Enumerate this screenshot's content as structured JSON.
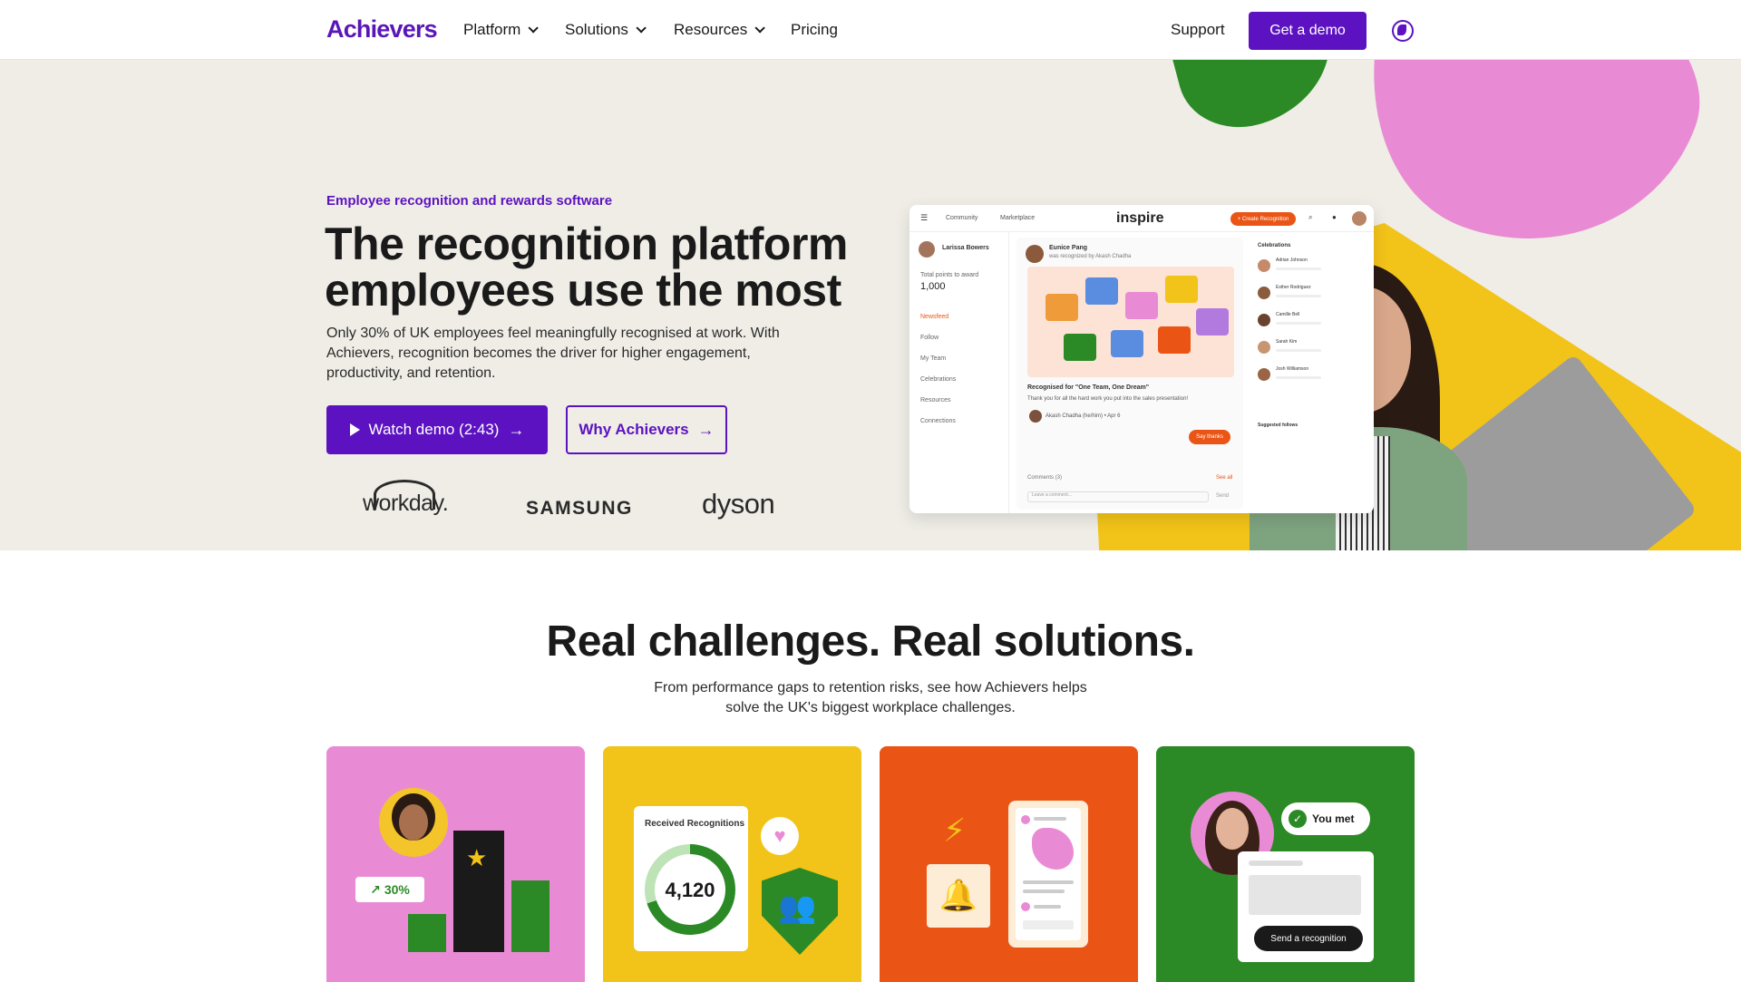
{
  "nav": {
    "logo": "Achievers",
    "items": [
      {
        "label": "Platform",
        "has_dropdown": true
      },
      {
        "label": "Solutions",
        "has_dropdown": true
      },
      {
        "label": "Resources",
        "has_dropdown": true
      },
      {
        "label": "Pricing",
        "has_dropdown": false
      }
    ],
    "support": "Support",
    "cta": "Get a demo",
    "globe_icon": "globe-icon"
  },
  "hero": {
    "eyebrow": "Employee recognition and rewards software",
    "title": "The recognition platform employees use the most",
    "lede": "Only 30% of UK employees feel meaningfully recognised at work. With Achievers, recognition becomes the driver for higher engagement, productivity, and retention.",
    "watch_label": "Watch demo (2:43)",
    "why_label": "Why Achievers",
    "logos": [
      "workday.",
      "SAMSUNG",
      "dyson"
    ]
  },
  "mock": {
    "app_title": "inspire",
    "tabs": [
      "Community",
      "Marketplace"
    ],
    "create_label": "+ Create Recognition",
    "user": "Larissa Bowers",
    "points_label": "Total points to award",
    "points_value": "1,000",
    "side_items": [
      "Newsfeed",
      "Follow",
      "My Team",
      "Celebrations",
      "Resources",
      "Connections"
    ],
    "post_author": "Eunice Pang",
    "post_sub": "was recognized by Akash Chadha",
    "post_title": "Recognised for \"One Team, One Dream\"",
    "post_body": "Thank you for all the hard work you put into the sales presentation!",
    "post_meta": "Akash Chadha (he/him) • Apr 6",
    "say_thanks": "Say thanks",
    "comments": "Comments (3)",
    "see_all": "See all",
    "comment_placeholder": "Leave a comment...",
    "send": "Send",
    "celebrations_title": "Celebrations",
    "people": [
      "Adrian Johnson",
      "Esther Rodriguez",
      "Camille Bell",
      "Sarah Kim",
      "Josh Williamson"
    ],
    "suggested": "Suggested follows"
  },
  "section": {
    "title": "Real challenges. Real solutions.",
    "subtitle": "From performance gaps to retention risks, see how Achievers helps solve the UK's biggest workplace challenges."
  },
  "cards": {
    "c1": {
      "percent": "30%"
    },
    "c2": {
      "panel_label": "Received Recognitions",
      "value": "4,120"
    },
    "c4": {
      "met_label": "You met",
      "send_label": "Send a recognition"
    }
  },
  "colors": {
    "brand_purple": "#5c12c1",
    "pink": "#e98bd4",
    "yellow": "#f2c318",
    "orange": "#ea5516",
    "green": "#2b8a26",
    "hero_bg": "#efede6"
  }
}
